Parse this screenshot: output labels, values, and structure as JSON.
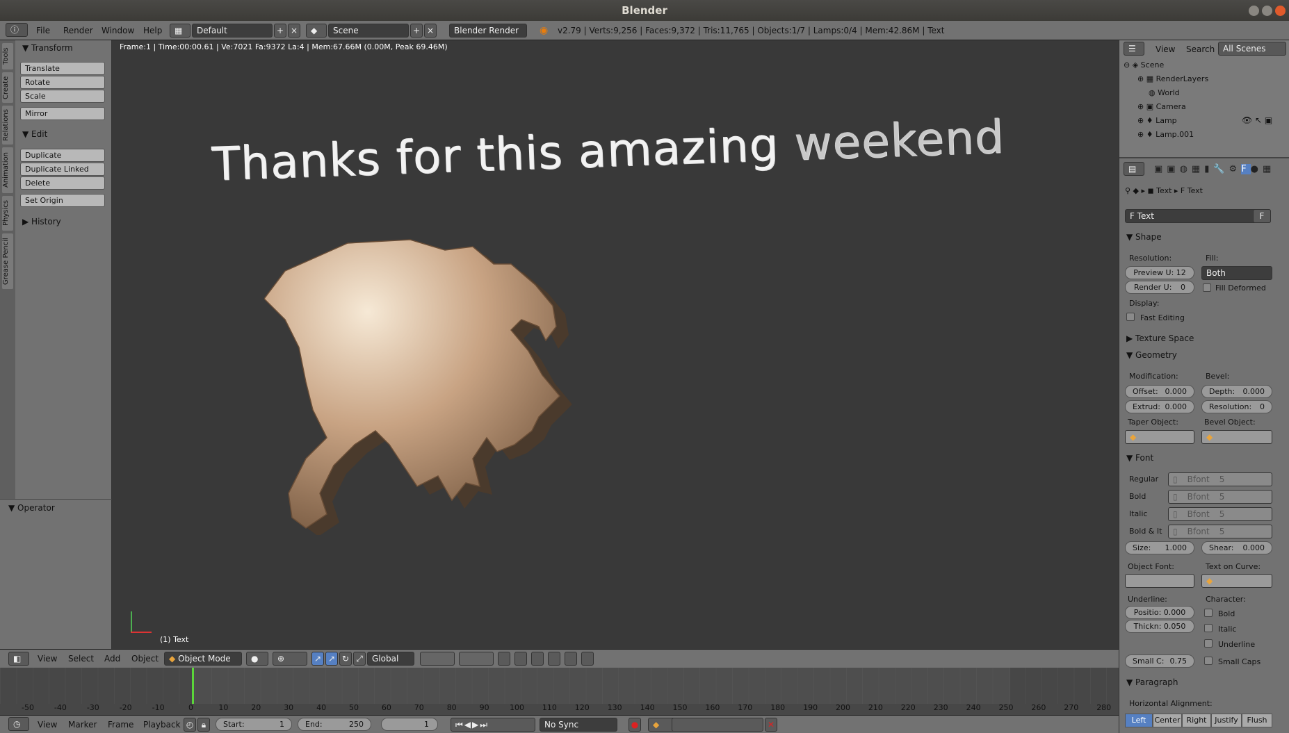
{
  "window": {
    "title": "Blender"
  },
  "menubar": {
    "items": [
      "File",
      "Render",
      "Window",
      "Help"
    ],
    "layout": "Default",
    "scene": "Scene",
    "engine": "Blender Render",
    "stats": "v2.79 | Verts:9,256 | Faces:9,372 | Tris:11,765 | Objects:1/7 | Lamps:0/4 | Mem:42.86M | Text"
  },
  "tabs": [
    "Tools",
    "Create",
    "Relations",
    "Animation",
    "Physics",
    "Grease Pencil"
  ],
  "toolshelf": {
    "transform": {
      "title": "Transform",
      "buttons": [
        "Translate",
        "Rotate",
        "Scale",
        "Mirror"
      ]
    },
    "edit": {
      "title": "Edit",
      "buttons": [
        "Duplicate",
        "Duplicate Linked",
        "Delete",
        "Set Origin"
      ]
    },
    "history": "History",
    "operator": "Operator"
  },
  "viewport": {
    "info": "Frame:1 | Time:00:00.61 | Ve:7021 Fa:9372 La:4 | Mem:67.66M (0.00M, Peak 69.46M)",
    "text_main": "Thanks for this amazing ",
    "text_dim": "weekend",
    "object_label": "(1) Text"
  },
  "header3d": {
    "items": [
      "View",
      "Select",
      "Add",
      "Object"
    ],
    "mode": "Object Mode",
    "orientation": "Global"
  },
  "timeline": {
    "ticks": [
      "-50",
      "-40",
      "-30",
      "-20",
      "-10",
      "0",
      "10",
      "20",
      "30",
      "40",
      "50",
      "60",
      "70",
      "80",
      "90",
      "100",
      "110",
      "120",
      "130",
      "140",
      "150",
      "160",
      "170",
      "180",
      "190",
      "200",
      "210",
      "220",
      "230",
      "240",
      "250",
      "260",
      "270",
      "280"
    ],
    "menu": [
      "View",
      "Marker",
      "Frame",
      "Playback"
    ],
    "start": "Start:",
    "start_val": "1",
    "end": "End:",
    "end_val": "250",
    "current": "1",
    "sync": "No Sync"
  },
  "outliner": {
    "header": [
      "View",
      "Search",
      "All Scenes"
    ],
    "rows": [
      "Scene",
      "RenderLayers",
      "World",
      "Camera",
      "Lamp",
      "Lamp.001"
    ]
  },
  "properties": {
    "breadcrumb": [
      "Text",
      "Text"
    ],
    "datablock": "Text",
    "shape": {
      "title": "Shape",
      "resolution": "Resolution:",
      "fill": "Fill:",
      "preview_u": "Preview U: 12",
      "render_u": "Render U:",
      "render_u_val": "0",
      "fill_val": "Both",
      "fill_deformed": "Fill Deformed",
      "display": "Display:",
      "fast_editing": "Fast Editing"
    },
    "texture_space": "Texture Space",
    "geometry": {
      "title": "Geometry",
      "modification": "Modification:",
      "bevel": "Bevel:",
      "offset": "Offset:",
      "offset_val": "0.000",
      "extrude": "Extrud:",
      "extrude_val": "0.000",
      "depth": "Depth:",
      "depth_val": "0.000",
      "resolution": "Resolution:",
      "resolution_val": "0",
      "taper": "Taper Object:",
      "bevel_object": "Bevel Object:"
    },
    "font": {
      "title": "Font",
      "rows": [
        "Regular",
        "Bold",
        "Italic",
        "Bold & It"
      ],
      "font_name": "Bfont",
      "users": "5",
      "size": "Size:",
      "size_val": "1.000",
      "shear": "Shear:",
      "shear_val": "0.000",
      "object_font": "Object Font:",
      "text_on_curve": "Text on Curve:",
      "underline": "Underline:",
      "character": "Character:",
      "position": "Positio: 0.000",
      "thickness": "Thickn: 0.050",
      "small_caps_scale": "Small C:",
      "small_caps_val": "0.75",
      "char_bold": "Bold",
      "char_italic": "Italic",
      "char_underline": "Underline",
      "char_smallcaps": "Small Caps"
    },
    "paragraph": {
      "title": "Paragraph",
      "alignment": "Horizontal Alignment:",
      "options": [
        "Left",
        "Center",
        "Right",
        "Justify",
        "Flush"
      ]
    }
  },
  "colors": {
    "accent": "#5680c2",
    "playhead": "#5bd63a"
  }
}
